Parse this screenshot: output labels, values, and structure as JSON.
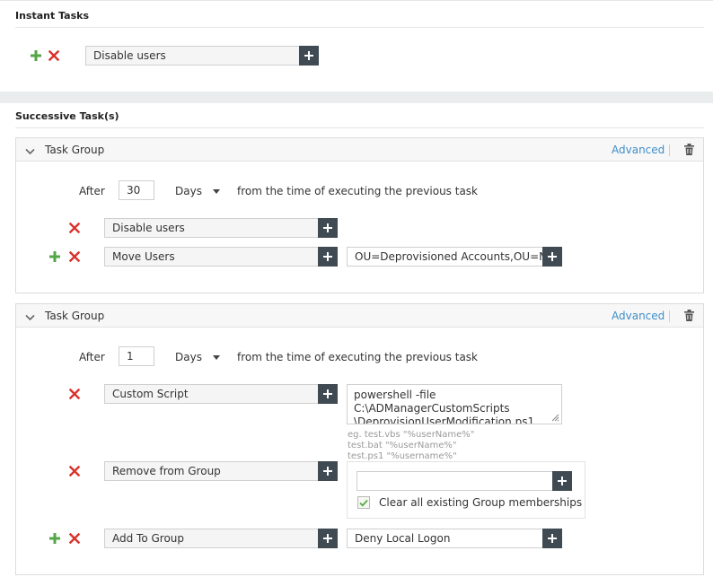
{
  "instant_tasks": {
    "title": "Instant Tasks",
    "task": {
      "value": "Disable users"
    }
  },
  "successive_tasks": {
    "title": "Successive Task(s)",
    "groups": [
      {
        "title": "Task Group",
        "advanced_label": "Advanced",
        "after_label": "After",
        "after_value": "30",
        "unit_label": "Days",
        "suffix": "from the time of executing the previous task",
        "tasks": [
          {
            "value": "Disable users"
          },
          {
            "value": "Move Users",
            "param": "OU=Deprovisioned Accounts,OU=N"
          }
        ]
      },
      {
        "title": "Task Group",
        "advanced_label": "Advanced",
        "after_label": "After",
        "after_value": "1",
        "unit_label": "Days",
        "suffix": "from the time of executing the previous task",
        "tasks": [
          {
            "value": "Custom Script",
            "script_lines": [
              "powershell -file",
              "C:\\ADManagerCustomScripts",
              "\\DeprovisionUserModification.ps1"
            ],
            "hints": [
              "eg. test.vbs \"%userName%\"",
              "test.bat \"%userName%\"",
              "test.ps1 \"%username%\""
            ]
          },
          {
            "value": "Remove from Group",
            "group_value": "",
            "checkbox_label": "Clear all existing Group memberships",
            "checkbox_checked": true
          },
          {
            "value": "Add To Group",
            "param": "Deny Local Logon"
          }
        ]
      }
    ]
  },
  "colors": {
    "accent_link": "#3e8ec9",
    "add_green": "#54a646",
    "remove_red": "#d9322b",
    "button_dark": "#3f4a52"
  },
  "icons": [
    "plus-icon",
    "close-icon",
    "chevron-down-icon",
    "trash-icon",
    "check-icon",
    "resize-grip-icon"
  ]
}
